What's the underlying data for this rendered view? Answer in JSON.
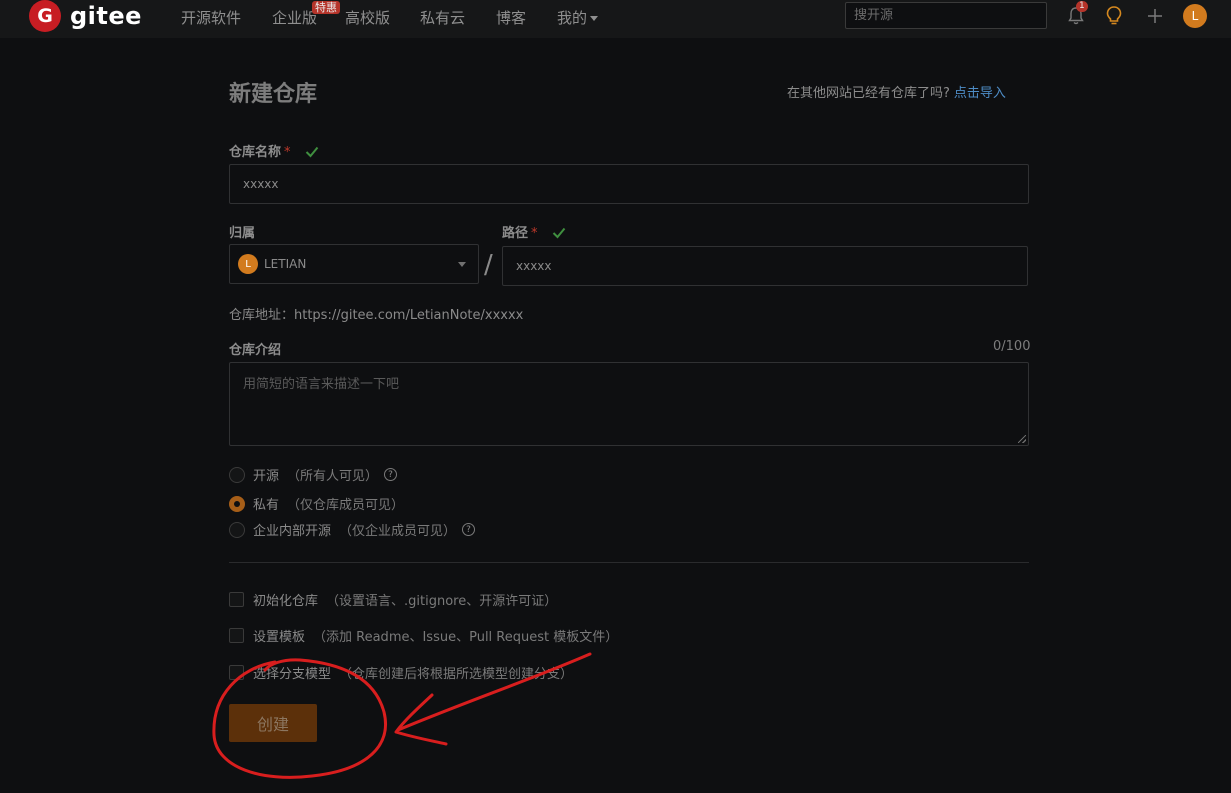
{
  "nav": {
    "brand": "gitee",
    "logo_letter": "G",
    "items": [
      {
        "label": "开源软件"
      },
      {
        "label": "企业版",
        "badge": "特惠"
      },
      {
        "label": "高校版"
      },
      {
        "label": "私有云"
      },
      {
        "label": "博客"
      },
      {
        "label": "我的"
      }
    ],
    "search_placeholder": "搜开源",
    "notification_count": "1",
    "avatar_letter": "L"
  },
  "page": {
    "title": "新建仓库",
    "import_hint": "在其他网站已经有仓库了吗?",
    "import_link": "点击导入"
  },
  "form": {
    "repo_name_label": "仓库名称",
    "required_mark": "*",
    "repo_name_value": "xxxxx",
    "owner_label": "归属",
    "owner_value": "LETIAN",
    "owner_avatar_letter": "L",
    "path_label": "路径",
    "path_value": "xxxxx",
    "separator": "/",
    "repo_url": "仓库地址：https://gitee.com/LetianNote/xxxxx",
    "desc_label": "仓库介绍",
    "desc_counter": "0/100",
    "desc_placeholder": "用简短的语言来描述一下吧",
    "visibility": [
      {
        "label": "开源",
        "note": "（所有人可见）",
        "selected": false,
        "help": true
      },
      {
        "label": "私有",
        "note": "（仅仓库成员可见）",
        "selected": true,
        "help": false
      },
      {
        "label": "企业内部开源",
        "note": "（仅企业成员可见）",
        "selected": false,
        "help": true
      }
    ],
    "options": [
      {
        "label": "初始化仓库",
        "note": "（设置语言、.gitignore、开源许可证）"
      },
      {
        "label": "设置模板",
        "note": "（添加 Readme、Issue、Pull Request 模板文件）"
      },
      {
        "label": "选择分支模型",
        "note": "（仓库创建后将根据所选模型创建分支）"
      }
    ],
    "submit_label": "创建",
    "help_glyph": "?"
  },
  "colors": {
    "accent": "#a65e18",
    "annotation": "#d81e1e",
    "link": "#4e8dc7",
    "valid": "#3f8f3f"
  }
}
